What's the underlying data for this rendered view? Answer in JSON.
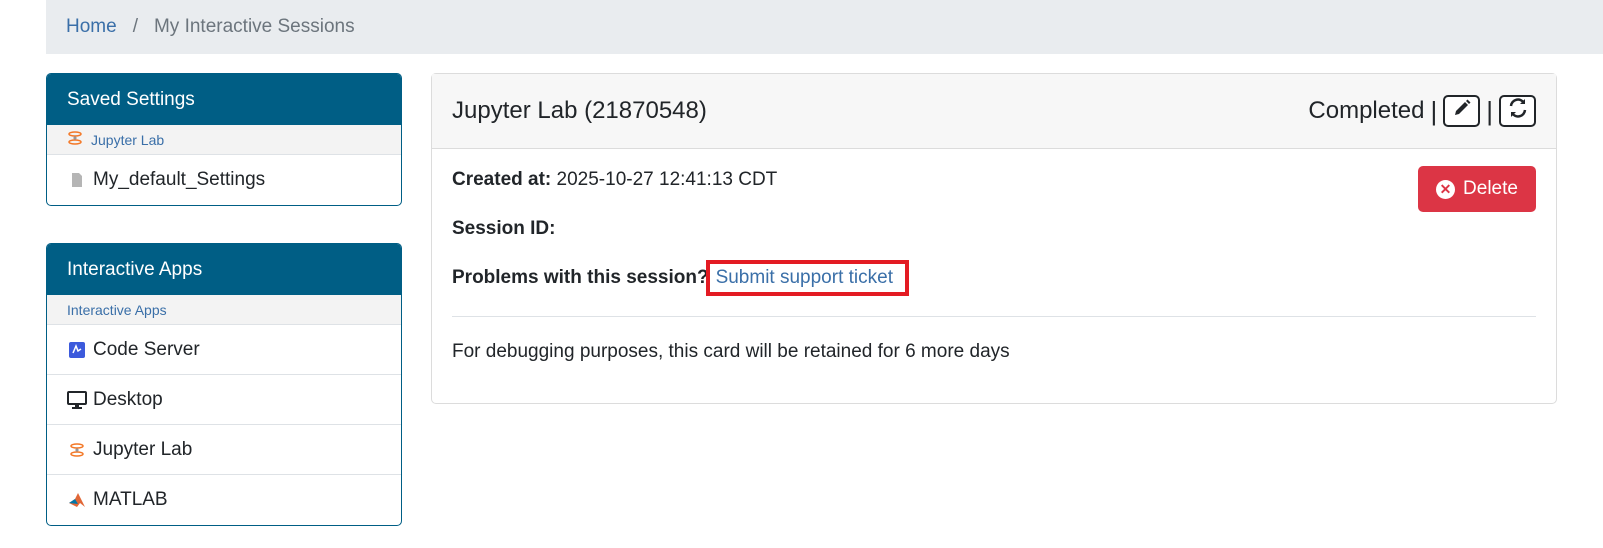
{
  "breadcrumb": {
    "home": "Home",
    "separator": "/",
    "current": "My Interactive Sessions"
  },
  "saved_settings": {
    "title": "Saved Settings",
    "group_label": "Jupyter Lab",
    "items": [
      {
        "label": "My_default_Settings",
        "icon": "file-icon"
      }
    ]
  },
  "interactive_apps": {
    "title": "Interactive Apps",
    "group_label": "Interactive Apps",
    "items": [
      {
        "label": "Code Server",
        "icon": "code-server-icon"
      },
      {
        "label": "Desktop",
        "icon": "monitor-icon"
      },
      {
        "label": "Jupyter Lab",
        "icon": "jupyter-icon"
      },
      {
        "label": "MATLAB",
        "icon": "matlab-icon"
      }
    ]
  },
  "session": {
    "title": "Jupyter Lab (21870548)",
    "status": "Completed",
    "separator": "|",
    "created_label": "Created at:",
    "created_value": "2025-10-27 12:41:13 CDT",
    "session_id_label": "Session ID:",
    "problems_label": "Problems with this session?",
    "support_link": "Submit support ticket",
    "delete_label": "Delete",
    "note": "For debugging purposes, this card will be retained for 6 more days"
  },
  "colors": {
    "header": "#005e85",
    "delete": "#dc3545",
    "link": "#3a6fa8",
    "highlight": "#e31b23"
  }
}
